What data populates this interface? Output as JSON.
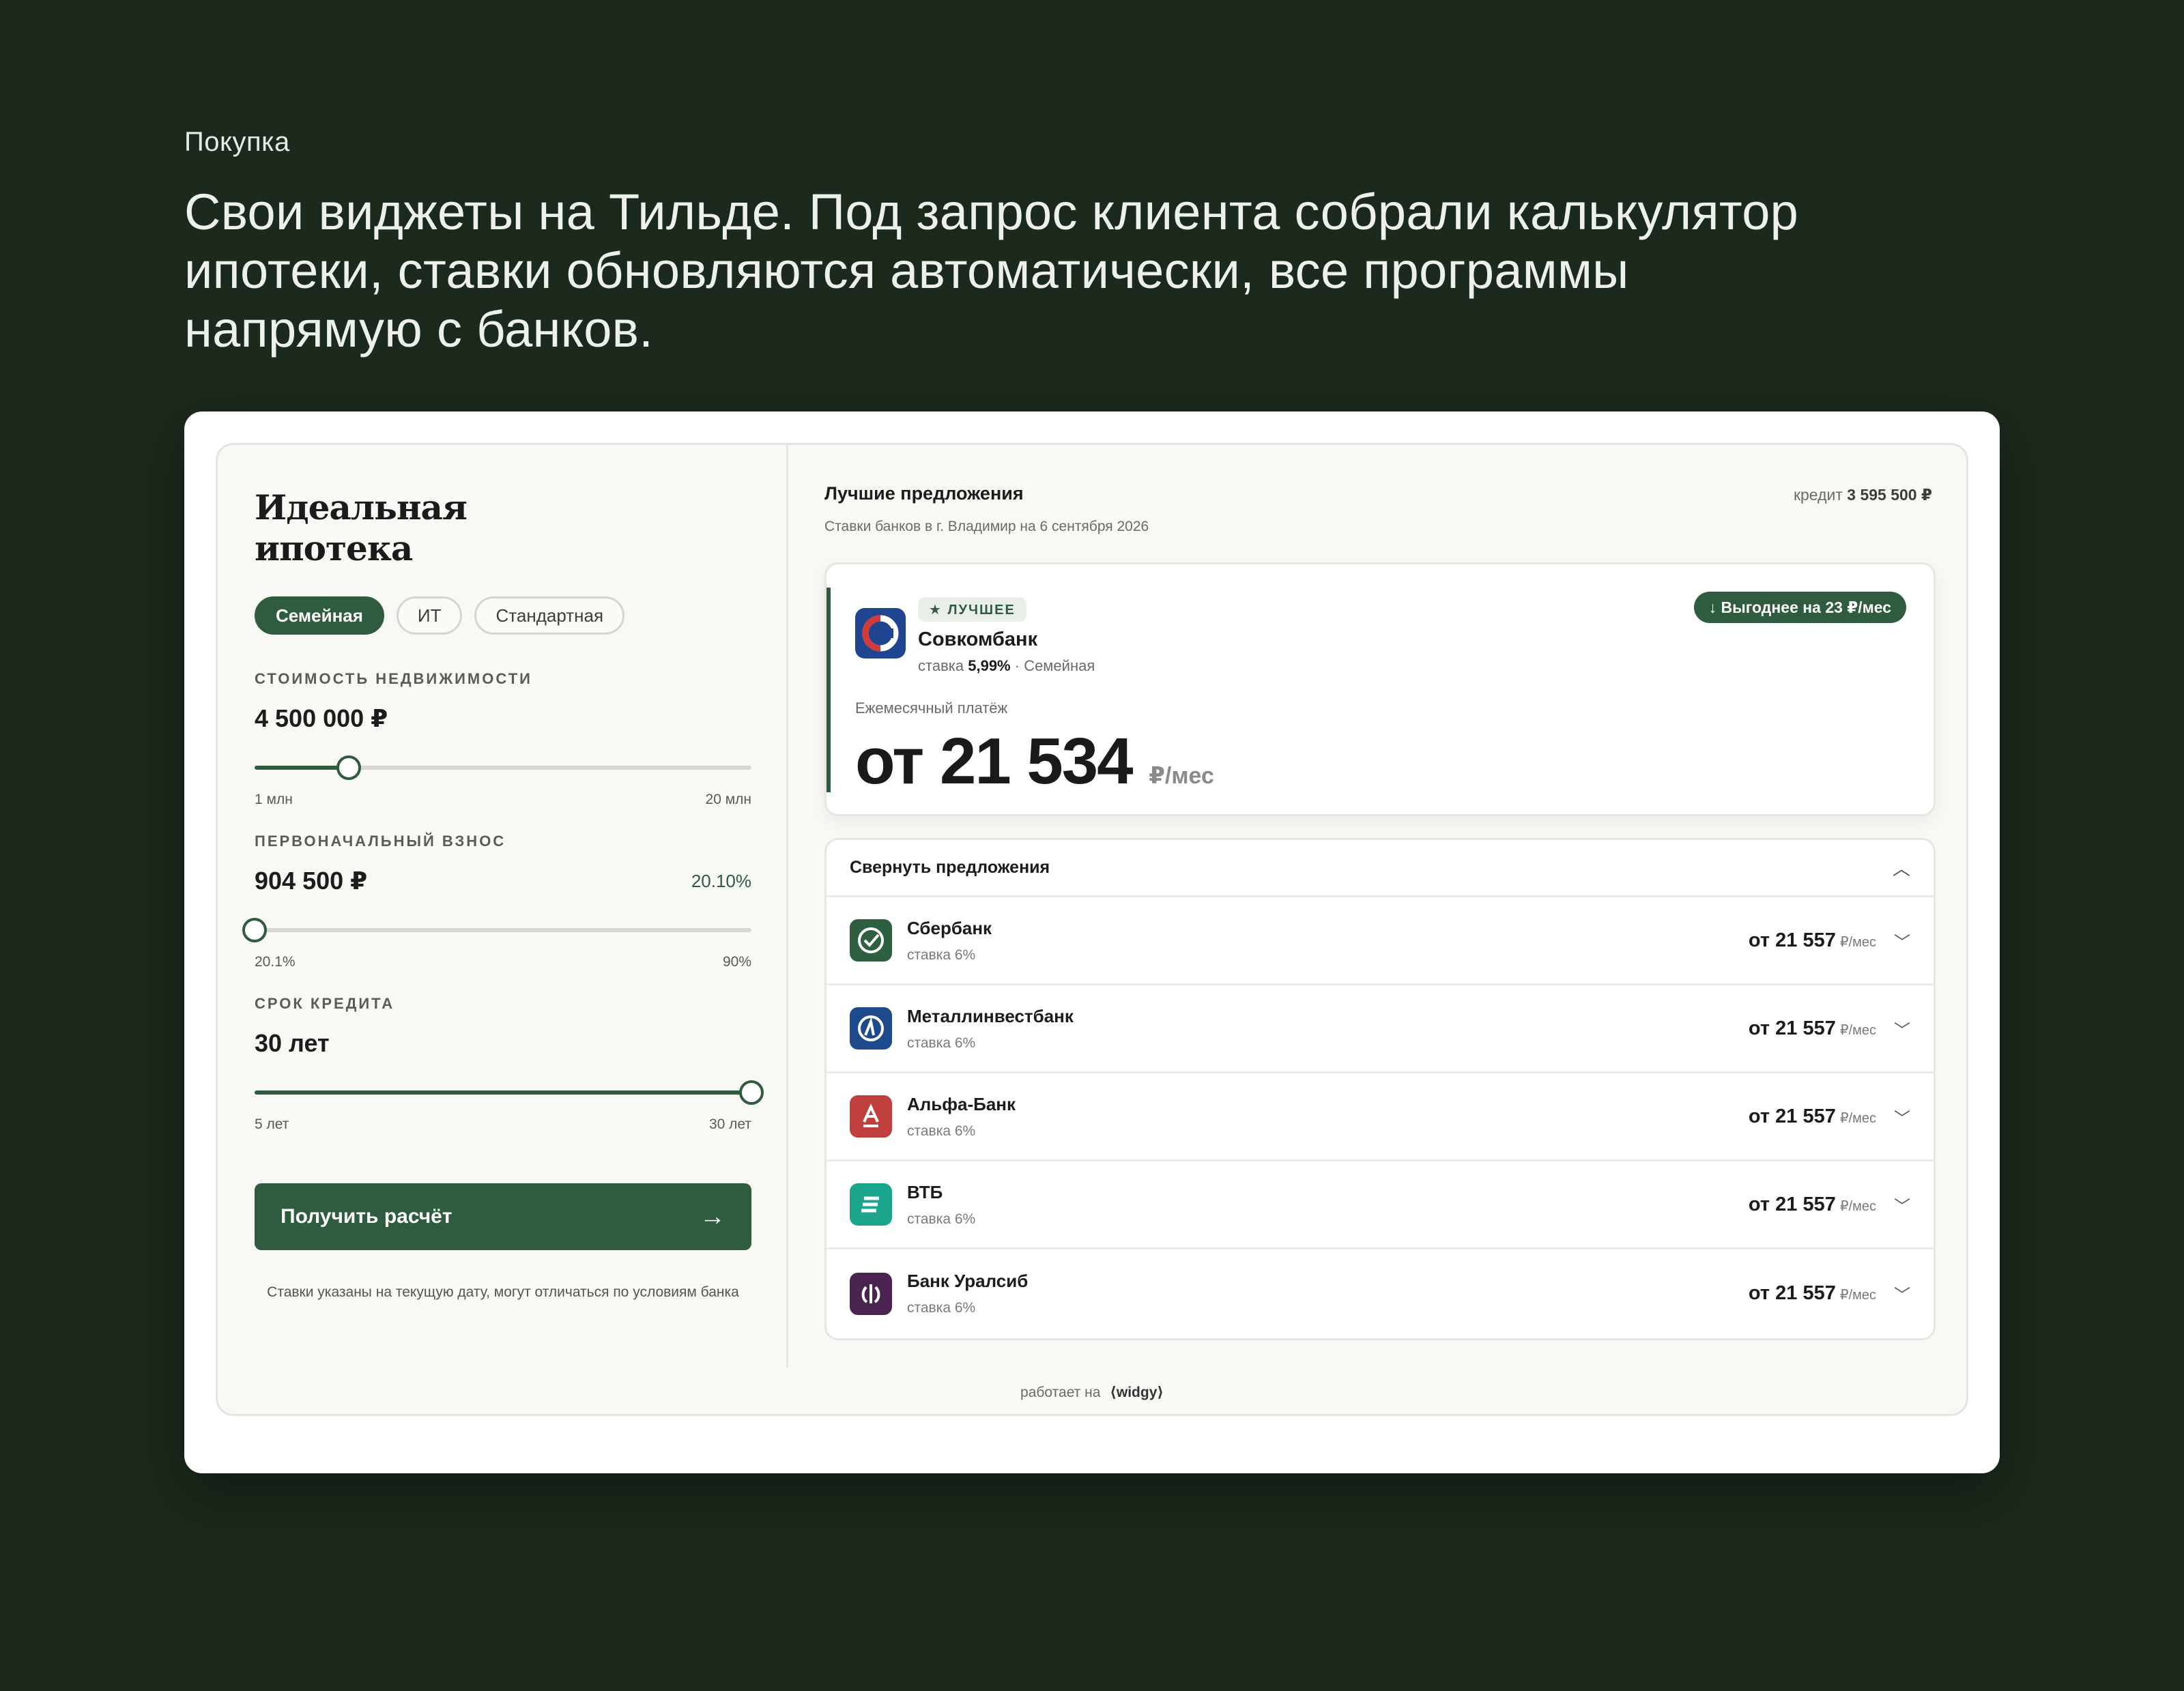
{
  "header": {
    "eyebrow": "Покупка",
    "headline_lines": [
      "Свои виджеты на Тильде. Под запрос клиента собрали  калькулятор",
      "ипотеки, ставки обновляются автоматически, все программы",
      "напрямую с банков."
    ]
  },
  "calculator": {
    "title_lines": [
      "Идеальная",
      "ипотека"
    ],
    "tabs": [
      {
        "label": "Семейная",
        "active": true
      },
      {
        "label": "ИТ",
        "active": false
      },
      {
        "label": "Стандартная",
        "active": false
      }
    ],
    "property": {
      "label": "СТОИМОСТЬ НЕДВИЖИМОСТИ",
      "value": "4 500 000 ₽",
      "min_label": "1 млн",
      "max_label": "20 млн",
      "fraction": 0.19
    },
    "down_payment": {
      "label": "ПЕРВОНАЧАЛЬНЫЙ ВЗНОС",
      "value": "904 500 ₽",
      "percent": "20.10%",
      "min_label": "20.1%",
      "max_label": "90%",
      "fraction": 0.0
    },
    "term": {
      "label": "СРОК КРЕДИТА",
      "value": "30 лет",
      "min_label": "5 лет",
      "max_label": "30 лет",
      "fraction": 1.0
    },
    "cta_label": "Получить расчёт",
    "disclaimer": "Ставки указаны на текущую дату, могут отличаться по условиям банка",
    "accent_color": "#2f5b3e"
  },
  "offers": {
    "title": "Лучшие предложения",
    "subtitle": "Ставки банков в г. Владимир на 6 сентября 2026",
    "credit_label": "кредит",
    "credit_value": "3 595 500 ₽",
    "best": {
      "badge": "★ ЛУЧШЕЕ",
      "bank": "Совкомбанк",
      "rate_prefix": "ставка",
      "rate": "5,99%",
      "program": "· Семейная",
      "savings": "↓ Выгоднее на 23 ₽/мес",
      "payment_label": "Ежемесячный платёж",
      "payment_value": "от 21 534",
      "payment_unit": "₽/мес"
    },
    "collapse_label": "Свернуть предложения",
    "list": [
      {
        "bank": "Сбербанк",
        "rate": "ставка 6%",
        "price": "от 21 557",
        "unit": "₽/мес",
        "logo_color": "#2e5f3e",
        "logo_icon": "check-icon"
      },
      {
        "bank": "Металлинвестбанк",
        "rate": "ставка 6%",
        "price": "от 21 557",
        "unit": "₽/мес",
        "logo_color": "#1d4a8c",
        "logo_icon": "metallinvest-icon"
      },
      {
        "bank": "Альфа-Банк",
        "rate": "ставка 6%",
        "price": "от 21 557",
        "unit": "₽/мес",
        "logo_color": "#c0403e",
        "logo_icon": "alfa-icon"
      },
      {
        "bank": "ВТБ",
        "rate": "ставка 6%",
        "price": "от 21 557",
        "unit": "₽/мес",
        "logo_color": "#1aa58c",
        "logo_icon": "vtb-icon"
      },
      {
        "bank": "Банк Уралсиб",
        "rate": "ставка 6%",
        "price": "от 21 557",
        "unit": "₽/мес",
        "logo_color": "#4a2350",
        "logo_icon": "uralsib-icon"
      }
    ]
  },
  "footer": {
    "powered_prefix": "работает на",
    "brand": "⟨widgy⟩"
  }
}
